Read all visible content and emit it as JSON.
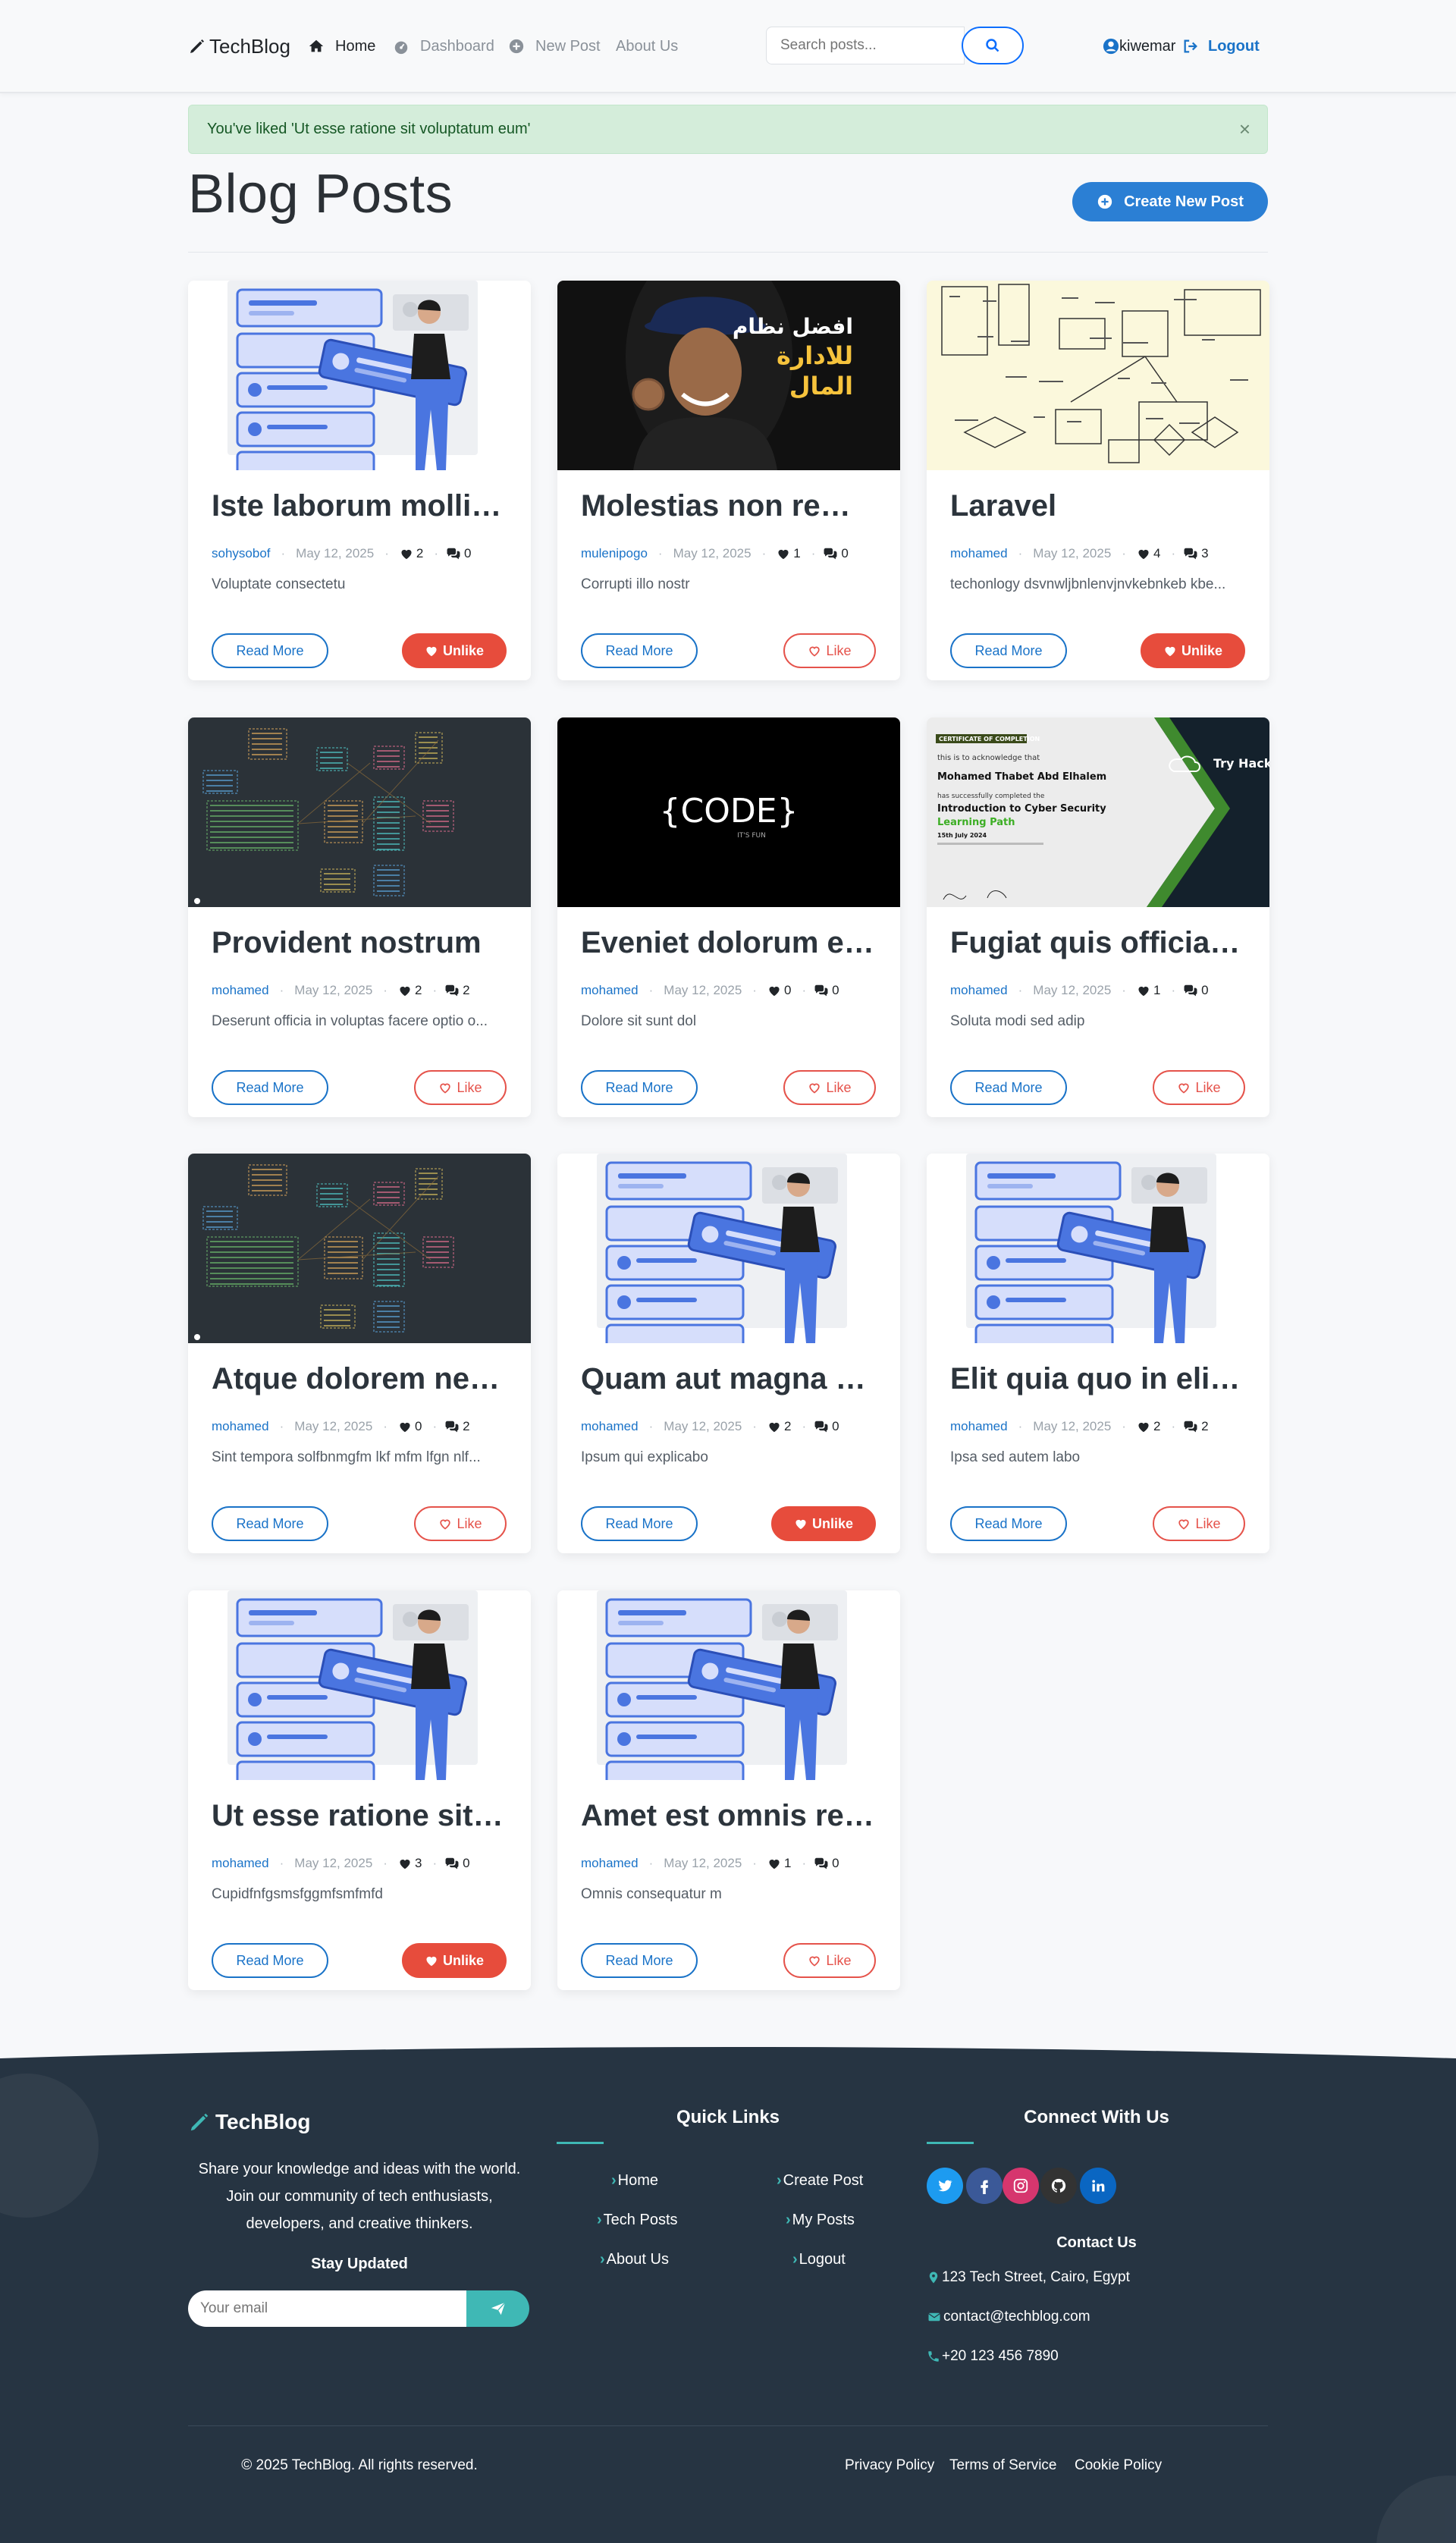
{
  "nav": {
    "brand": "TechBlog",
    "items": [
      {
        "label": "Home",
        "icon": "home-icon",
        "active": true
      },
      {
        "label": "Dashboard",
        "icon": "dashboard-icon",
        "active": false
      },
      {
        "label": "New Post",
        "icon": "plus-circle-icon",
        "active": false
      },
      {
        "label": "About Us",
        "icon": "",
        "active": false
      }
    ],
    "search_placeholder": "Search posts...",
    "username": "kiwemar",
    "logout": "Logout"
  },
  "alert": {
    "message": "You've liked 'Ut esse ratione sit voluptatum eum'",
    "close": "×"
  },
  "page": {
    "title": "Blog Posts",
    "create_button": "Create New Post"
  },
  "posts": [
    {
      "title": "Iste laborum molliti...",
      "author": "sohysobof",
      "date": "May 12, 2025",
      "likes": "2",
      "comments": "0",
      "excerpt": "Voluptate consectetu",
      "read_more": "Read More",
      "like_label": "Unlike",
      "liked": true
    },
    {
      "title": "Molestias non rem ...",
      "author": "mulenipogo",
      "date": "May 12, 2025",
      "likes": "1",
      "comments": "0",
      "excerpt": "Corrupti illo nostr",
      "read_more": "Read More",
      "like_label": "Like",
      "liked": false
    },
    {
      "title": "Laravel",
      "author": "mohamed",
      "date": "May 12, 2025",
      "likes": "4",
      "comments": "3",
      "excerpt": "techonlogy dsvnwljbnlenvjnvkebnkeb kbe...",
      "read_more": "Read More",
      "like_label": "Unlike",
      "liked": true
    },
    {
      "title": "Provident nostrum",
      "author": "mohamed",
      "date": "May 12, 2025",
      "likes": "2",
      "comments": "2",
      "excerpt": "Deserunt officia in voluptas facere optio o...",
      "read_more": "Read More",
      "like_label": "Like",
      "liked": false
    },
    {
      "title": "Eveniet dolorum est...",
      "author": "mohamed",
      "date": "May 12, 2025",
      "likes": "0",
      "comments": "0",
      "excerpt": "Dolore sit sunt dol",
      "read_more": "Read More",
      "like_label": "Like",
      "liked": false
    },
    {
      "title": "Fugiat quis officia p...",
      "author": "mohamed",
      "date": "May 12, 2025",
      "likes": "1",
      "comments": "0",
      "excerpt": "Soluta modi sed adip",
      "read_more": "Read More",
      "like_label": "Like",
      "liked": false
    },
    {
      "title": "Atque dolorem nec...",
      "author": "mohamed",
      "date": "May 12, 2025",
      "likes": "0",
      "comments": "2",
      "excerpt": "Sint tempora solfbnmgfm lkf mfm lfgn nlf...",
      "read_more": "Read More",
      "like_label": "Like",
      "liked": false
    },
    {
      "title": "Quam aut magna ei...",
      "author": "mohamed",
      "date": "May 12, 2025",
      "likes": "2",
      "comments": "0",
      "excerpt": "Ipsum qui explicabo",
      "read_more": "Read More",
      "like_label": "Unlike",
      "liked": true
    },
    {
      "title": "Elit quia quo in elig...",
      "author": "mohamed",
      "date": "May 12, 2025",
      "likes": "2",
      "comments": "2",
      "excerpt": "Ipsa sed autem labo",
      "read_more": "Read More",
      "like_label": "Like",
      "liked": false
    },
    {
      "title": "Ut esse ratione sit v...",
      "author": "mohamed",
      "date": "May 12, 2025",
      "likes": "3",
      "comments": "0",
      "excerpt": "Cupidfnfgsmsfggmfsmfmfd",
      "read_more": "Read More",
      "like_label": "Unlike",
      "liked": true
    },
    {
      "title": "Amet est omnis rep...",
      "author": "mohamed",
      "date": "May 12, 2025",
      "likes": "1",
      "comments": "0",
      "excerpt": "Omnis consequatur m",
      "read_more": "Read More",
      "like_label": "Like",
      "liked": false
    }
  ],
  "images": {
    "arabic_line1": "افضل نظام",
    "arabic_line2": "للادارة",
    "arabic_line3": "المال",
    "code_text": "{CODE}",
    "code_sub": "IT'S FUN",
    "cert_badge": "CERTIFICATE OF COMPLETION",
    "cert_ack": "this is to acknowledge that",
    "cert_name": "Mohamed Thabet Abd Elhalem",
    "cert_has": "has successfully completed the",
    "cert_course": "Introduction to Cyber Security",
    "cert_path": "Learning Path",
    "cert_date": "15th July 2024",
    "cert_brand": "Try Hack Me"
  },
  "footer": {
    "brand": "TechBlog",
    "description": "Share your knowledge and ideas with the world. Join our community of tech enthusiasts, developers, and creative thinkers.",
    "stay_updated": "Stay Updated",
    "email_placeholder": "Your email",
    "quick_links_title": "Quick Links",
    "quick_links": [
      "Home",
      "Create Post",
      "Tech Posts",
      "My Posts",
      "About Us",
      "Logout"
    ],
    "connect_title": "Connect With Us",
    "social": [
      "twitter-icon",
      "facebook-icon",
      "instagram-icon",
      "github-icon",
      "linkedin-icon"
    ],
    "contact_title": "Contact Us",
    "address": "123 Tech Street, Cairo, Egypt",
    "email": "contact@techblog.com",
    "phone": "+20 123 456 7890",
    "copyright": "© 2025 TechBlog. All rights reserved.",
    "bottom_links": [
      "Privacy Policy",
      "Terms of Service",
      "Cookie Policy"
    ]
  }
}
